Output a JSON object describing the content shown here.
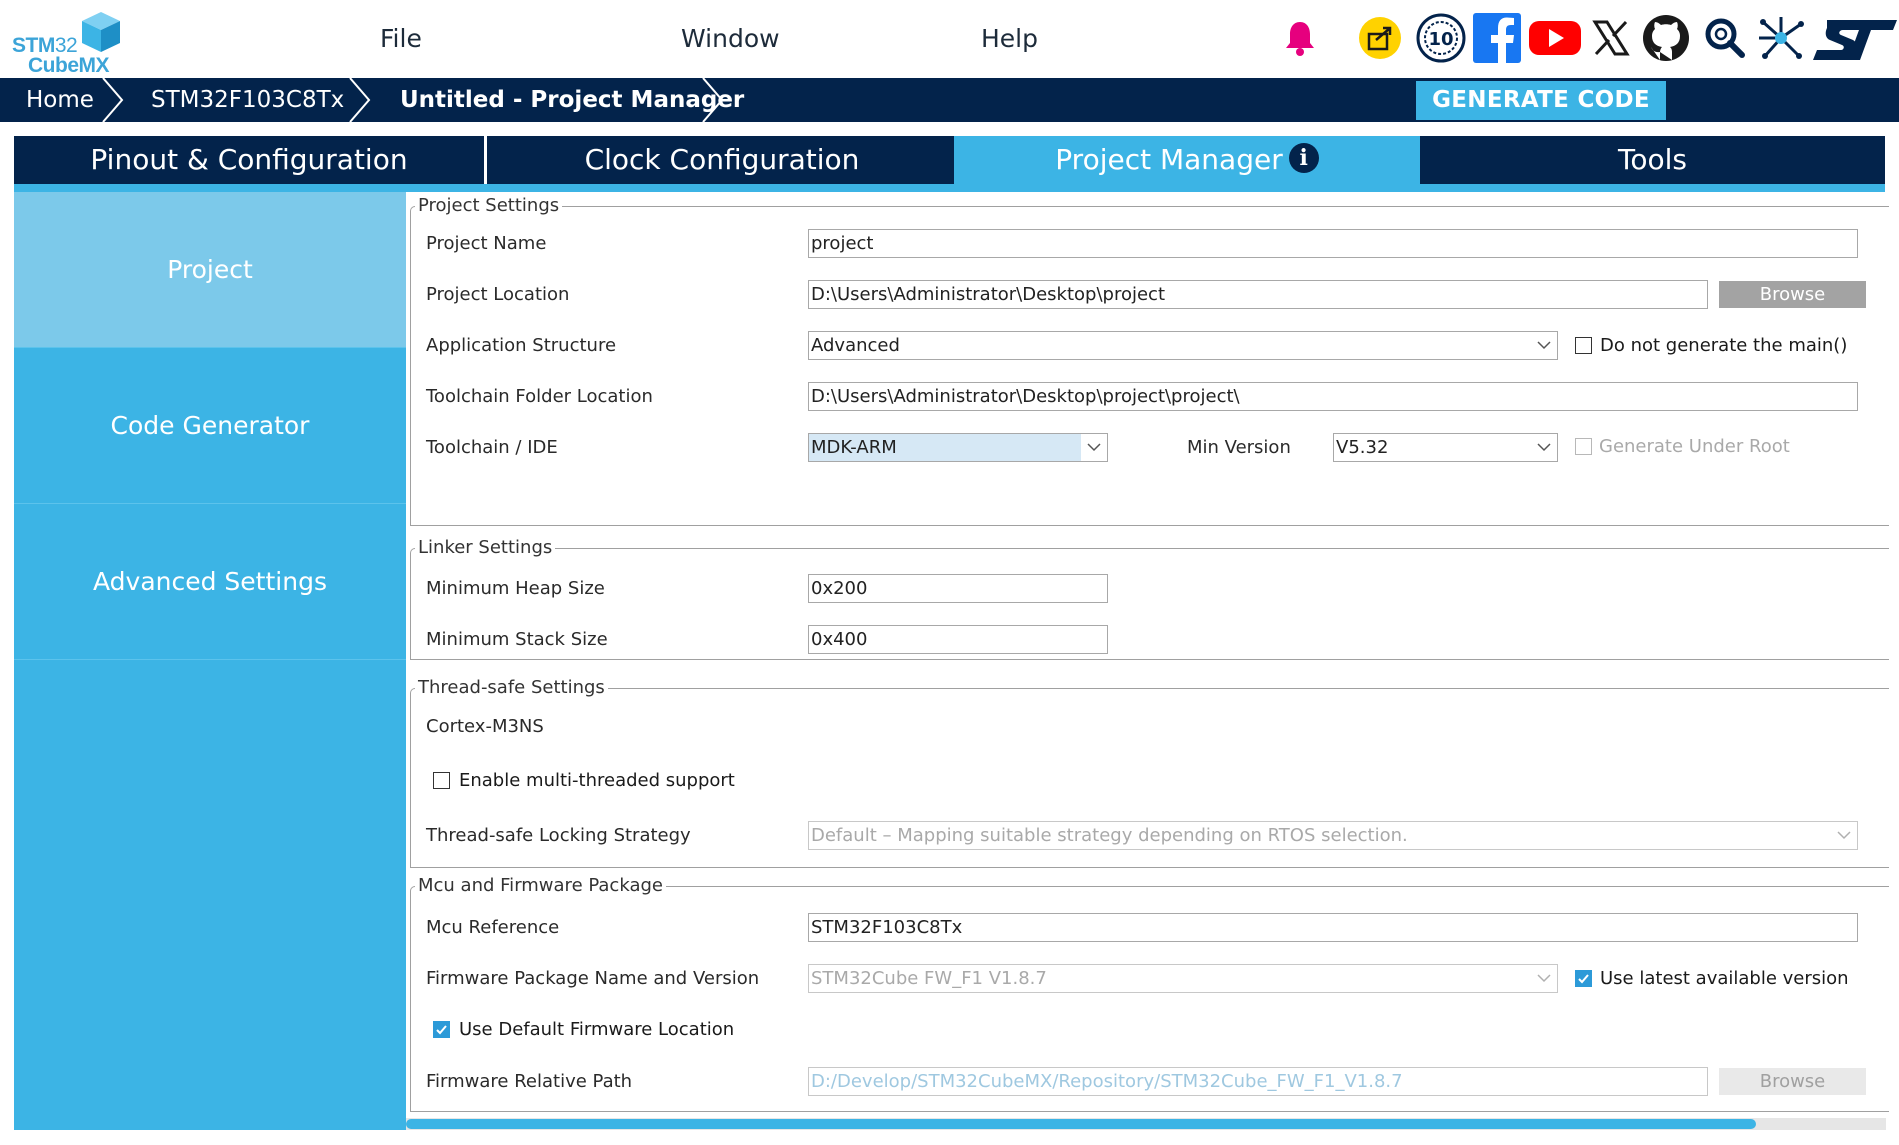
{
  "logo": {
    "line1_bold": "STM",
    "line1_rest": "32",
    "line2": "CubeMX"
  },
  "menu": {
    "file": "File",
    "window": "Window",
    "help": "Help"
  },
  "top_icons": [
    "bell-icon",
    "share-icon",
    "anniversary-10-icon",
    "facebook-icon",
    "youtube-icon",
    "x-icon",
    "github-icon",
    "search-icon",
    "network-icon",
    "st-logo-icon"
  ],
  "anniversary_badge": "10",
  "breadcrumb": {
    "home": "Home",
    "mcu": "STM32F103C8Tx",
    "current": "Untitled - Project Manager",
    "generate_code": "GENERATE CODE"
  },
  "tabs": [
    {
      "label": "Pinout & Configuration",
      "active": false
    },
    {
      "label": "Clock Configuration",
      "active": false
    },
    {
      "label": "Project Manager",
      "active": true
    },
    {
      "label": "Tools",
      "active": false
    }
  ],
  "tab_info_glyph": "i",
  "sidenav": [
    {
      "label": "Project",
      "active": true
    },
    {
      "label": "Code Generator",
      "active": false
    },
    {
      "label": "Advanced Settings",
      "active": false
    }
  ],
  "project_settings": {
    "title": "Project Settings",
    "project_name_label": "Project Name",
    "project_name": "project",
    "project_location_label": "Project Location",
    "project_location": "D:\\Users\\Administrator\\Desktop\\project",
    "browse": "Browse",
    "app_structure_label": "Application Structure",
    "app_structure": "Advanced",
    "no_main_label": "Do not generate the main()",
    "no_main_checked": false,
    "toolchain_folder_label": "Toolchain Folder Location",
    "toolchain_folder": "D:\\Users\\Administrator\\Desktop\\project\\project\\",
    "toolchain_ide_label": "Toolchain / IDE",
    "toolchain_ide": "MDK-ARM",
    "min_version_label": "Min Version",
    "min_version": "V5.32",
    "gen_under_root_label": "Generate Under Root",
    "gen_under_root_checked": false
  },
  "linker_settings": {
    "title": "Linker Settings",
    "heap_label": "Minimum Heap Size",
    "heap": "0x200",
    "stack_label": "Minimum Stack Size",
    "stack": "0x400"
  },
  "thread_settings": {
    "title": "Thread-safe Settings",
    "core": "Cortex-M3NS",
    "multithread_label": "Enable multi-threaded support",
    "multithread_checked": false,
    "locking_label": "Thread-safe Locking Strategy",
    "locking": "Default – Mapping suitable strategy depending on RTOS selection."
  },
  "mcu_firmware": {
    "title": "Mcu and Firmware Package",
    "mcu_ref_label": "Mcu Reference",
    "mcu_ref": "STM32F103C8Tx",
    "fw_label": "Firmware Package Name and Version",
    "fw": "STM32Cube FW_F1 V1.8.7",
    "use_latest_label": "Use latest available version",
    "use_latest_checked": true,
    "use_default_loc_label": "Use Default Firmware Location",
    "use_default_loc_checked": true,
    "fw_path_label": "Firmware Relative Path",
    "fw_path": "D:/Develop/STM32CubeMX/Repository/STM32Cube_FW_F1_V1.8.7",
    "browse": "Browse"
  },
  "colors": {
    "navy": "#03234b",
    "accent": "#3cb4e5",
    "side_active": "#7cc9ea",
    "bell": "#e6007e",
    "facebook": "#1877f2",
    "youtube": "#ff0000"
  }
}
